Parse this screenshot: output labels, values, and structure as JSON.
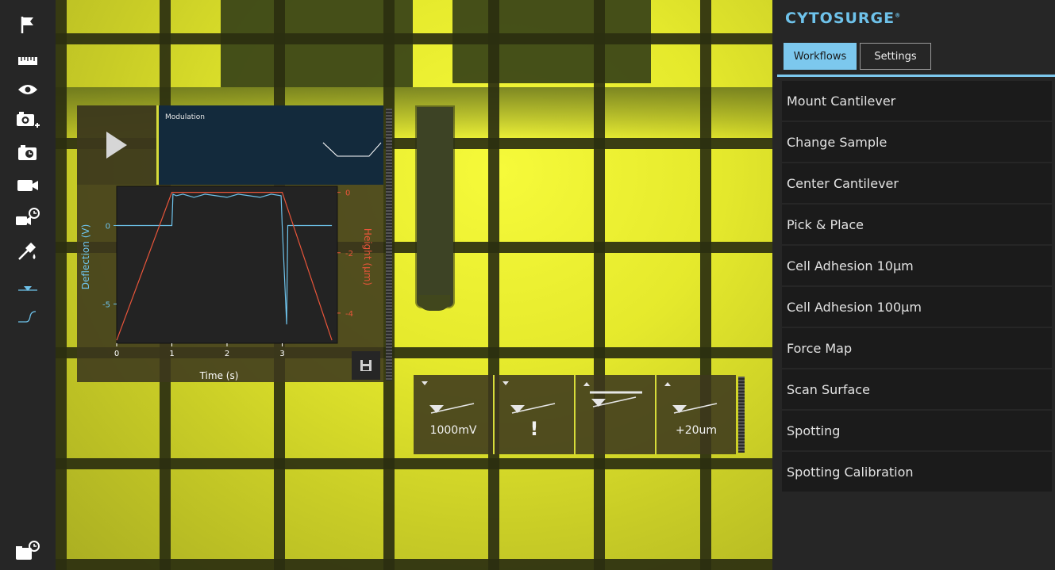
{
  "brand": {
    "name": "CYTOSURGE",
    "mark": "®",
    "color": "#6ec2ea"
  },
  "tabs": {
    "workflows": "Workflows",
    "settings": "Settings",
    "active": "Workflows"
  },
  "workflows": [
    "Mount Cantilever",
    "Change Sample",
    "Center Cantilever",
    "Pick & Place",
    "Cell Adhesion 10µm",
    "Cell Adhesion 100µm",
    "Force Map",
    "Scan Surface",
    "Spotting",
    "Spotting Calibration"
  ],
  "toolbar_icons": [
    "flag-icon",
    "ruler-icon",
    "eye-icon",
    "camera-add-icon",
    "camera-timer-icon",
    "video-icon",
    "video-history-icon",
    "pipette-icon",
    "marker-triangle-icon",
    "signal-curve-icon",
    "folder-history-icon"
  ],
  "modulation": {
    "label": "Modulation"
  },
  "controls": [
    {
      "label": "1000mV",
      "icon": "cantilever-down-icon"
    },
    {
      "label": "!",
      "icon": "cantilever-warning-icon"
    },
    {
      "label": "",
      "icon": "cantilever-up-icon"
    },
    {
      "label": "+20um",
      "icon": "cantilever-up-step-icon"
    }
  ],
  "colors": {
    "deflection": "#6ec2ea",
    "height": "#e8553a",
    "panel": "#262626",
    "accent": "#7cc8ee"
  },
  "chart_data": {
    "type": "line",
    "xlabel": "Time (s)",
    "ylabel_left": "Deflection (V)",
    "ylabel_right": "Height (µm)",
    "x_ticks": [
      0,
      1,
      2,
      3
    ],
    "y_left_ticks": [
      0,
      -5
    ],
    "y_left_tick_labels": [
      "0",
      "-5"
    ],
    "y_right_ticks": [
      0,
      -2,
      -4
    ],
    "y_right_tick_labels": [
      "0",
      "-2",
      "-4"
    ],
    "xlim": [
      0,
      4
    ],
    "ylim_left": [
      -7.5,
      2.5
    ],
    "ylim_right": [
      -5,
      0.2
    ],
    "series": [
      {
        "name": "Deflection (V)",
        "axis": "left",
        "color": "#6ec2ea",
        "x": [
          0,
          1.0,
          1.02,
          1.08,
          1.2,
          1.4,
          1.6,
          1.8,
          2.0,
          2.2,
          2.4,
          2.6,
          2.8,
          2.98,
          3.0,
          3.08,
          3.1,
          3.2,
          3.4,
          3.7,
          3.9
        ],
        "y": [
          0,
          0,
          2.0,
          1.9,
          2.0,
          1.8,
          2.0,
          1.9,
          1.8,
          2.0,
          1.9,
          1.8,
          2.0,
          1.9,
          0,
          -6.3,
          0,
          0,
          0,
          0,
          0
        ]
      },
      {
        "name": "Height (µm)",
        "axis": "right",
        "color": "#e8553a",
        "x": [
          0,
          1.0,
          1.5,
          2.0,
          2.5,
          3.0,
          3.9
        ],
        "y": [
          -4.9,
          0,
          0,
          0,
          0,
          0,
          -4.9
        ]
      }
    ]
  }
}
